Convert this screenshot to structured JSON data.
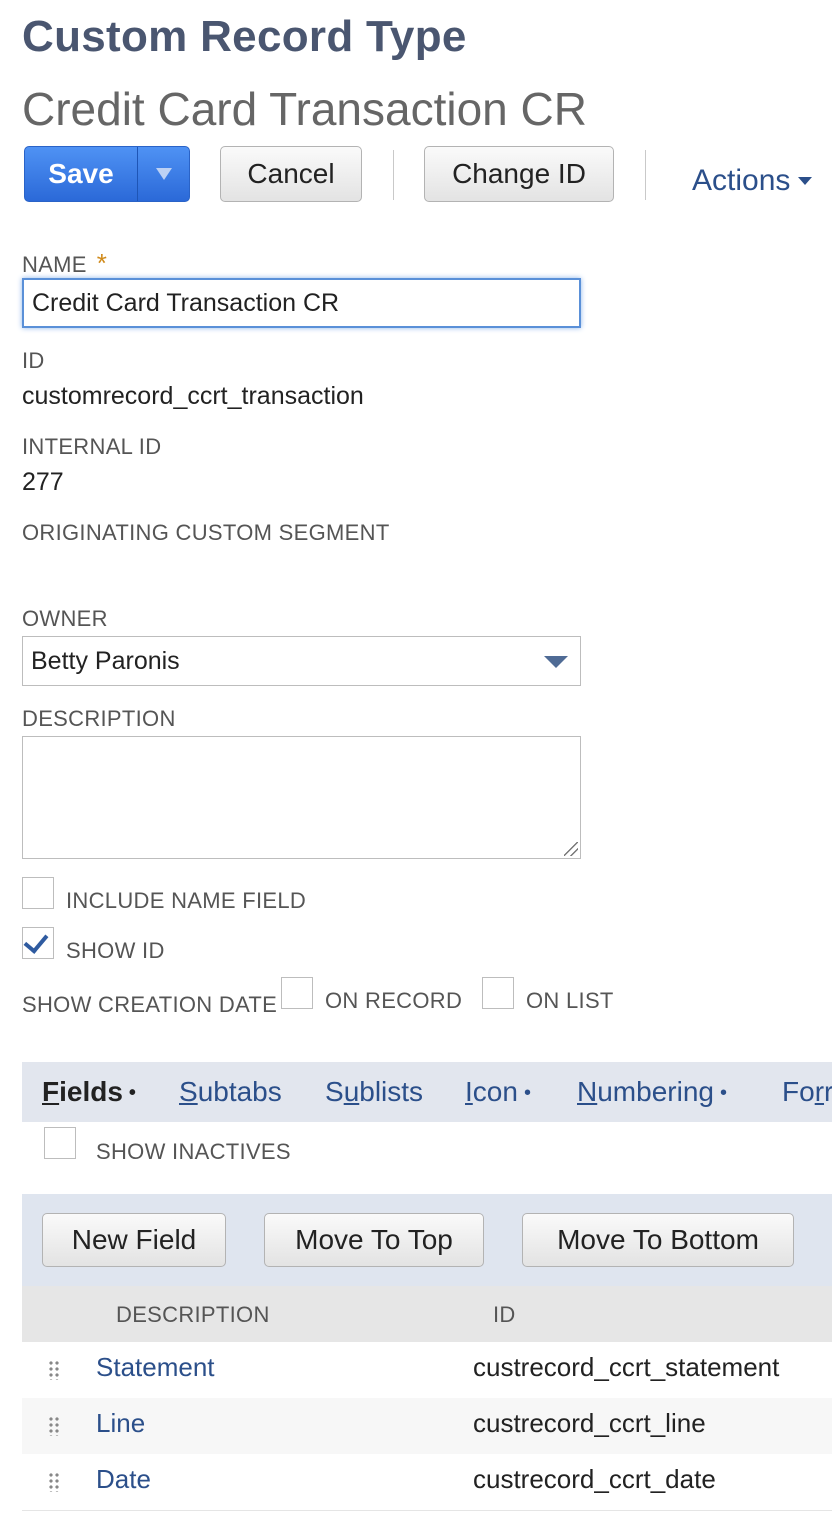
{
  "page": {
    "record_type": "Custom Record Type",
    "record_name": "Credit Card Transaction CR"
  },
  "toolbar": {
    "save": "Save",
    "cancel": "Cancel",
    "change_id": "Change ID",
    "actions": "Actions"
  },
  "form": {
    "name_label": "NAME",
    "name_required": "*",
    "name_value": "Credit Card Transaction CR",
    "id_label": "ID",
    "id_value": "customrecord_ccrt_transaction",
    "internal_id_label": "INTERNAL ID",
    "internal_id_value": "277",
    "originating_label": "ORIGINATING CUSTOM SEGMENT",
    "owner_label": "OWNER",
    "owner_value": "Betty Paronis",
    "description_label": "DESCRIPTION",
    "include_name_label": "INCLUDE NAME FIELD",
    "include_name_checked": false,
    "show_id_label": "SHOW ID",
    "show_id_checked": true,
    "show_creation_date_label": "SHOW CREATION DATE",
    "on_record_label": "ON RECORD",
    "on_record_checked": false,
    "on_list_label": "ON LIST",
    "on_list_checked": false
  },
  "tabs": [
    {
      "label": "Fields",
      "key": "F",
      "rest": "ields",
      "dot": "•"
    },
    {
      "label": "Subtabs",
      "key": "S",
      "rest": "ubtabs",
      "dot": ""
    },
    {
      "label": "Sublists",
      "pre": "S",
      "key": "u",
      "rest": "blists",
      "dot": ""
    },
    {
      "label": "Icon",
      "key": "I",
      "rest": "con",
      "dot": "•"
    },
    {
      "label": "Numbering",
      "key": "N",
      "rest": "umbering",
      "dot": "•"
    },
    {
      "label": "Forr",
      "pre": "Fo",
      "key": "r",
      "rest": "r",
      "dot": ""
    }
  ],
  "fields_tab": {
    "show_inactives_label": "SHOW INACTIVES",
    "show_inactives_checked": false,
    "new_field": "New Field",
    "move_top": "Move To Top",
    "move_bottom": "Move To Bottom",
    "columns": [
      "DESCRIPTION",
      "ID"
    ],
    "rows": [
      {
        "description": "Statement",
        "id": "custrecord_ccrt_statement"
      },
      {
        "description": "Line",
        "id": "custrecord_ccrt_line"
      },
      {
        "description": "Date",
        "id": "custrecord_ccrt_date"
      }
    ]
  },
  "colors": {
    "accent": "#2b4f8a",
    "save_blue": "#2b69d8",
    "title": "#4a5670",
    "required": "#d08a1a"
  }
}
